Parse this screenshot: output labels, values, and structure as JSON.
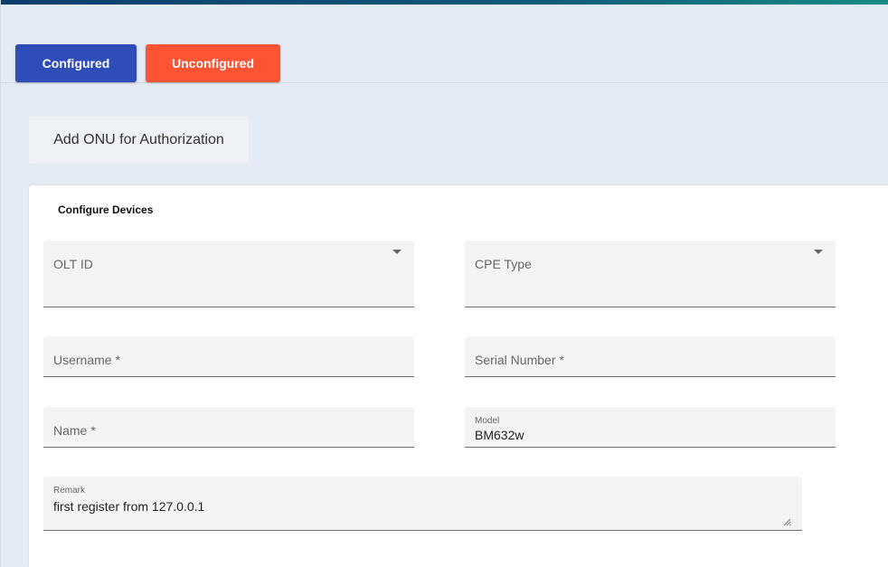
{
  "tabs": {
    "configured_label": "Configured",
    "unconfigured_label": "Unconfigured"
  },
  "actions": {
    "add_onu_label": "Add ONU for Authorization"
  },
  "form": {
    "title": "Configure Devices",
    "olt_id": {
      "label": "OLT ID",
      "icon": "dropdown-caret-icon"
    },
    "cpe_type": {
      "label": "CPE Type",
      "icon": "dropdown-caret-icon"
    },
    "username": {
      "label": "Username *"
    },
    "serial_number": {
      "label": "Serial Number *"
    },
    "name": {
      "label": "Name *"
    },
    "model": {
      "label": "Model",
      "value": "BM632w"
    },
    "remark": {
      "label": "Remark",
      "value": "first register from 127.0.0.1",
      "icon": "resize-handle-icon"
    }
  },
  "colors": {
    "configured_tab": "#2f4db8",
    "unconfigured_tab": "#ff5434",
    "page_background": "#e5ebf4"
  }
}
